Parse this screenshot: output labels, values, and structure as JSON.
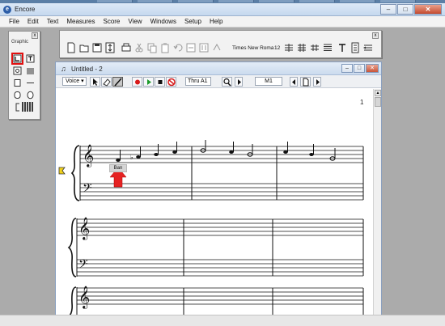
{
  "window": {
    "title": "Encore",
    "app_icon_letter": "e",
    "minimize": "–",
    "maximize": "□",
    "close": "✕"
  },
  "menubar": {
    "items": [
      "File",
      "Edit",
      "Text",
      "Measures",
      "Score",
      "View",
      "Windows",
      "Setup",
      "Help"
    ]
  },
  "palette": {
    "title": "Graphic",
    "close": "x",
    "selected_tool": "lyric-tool"
  },
  "toolbar": {
    "close": "x",
    "font_name": "Times New Roma",
    "font_size": "12"
  },
  "document": {
    "title": "Untitled - 2",
    "doc_icon": "♫",
    "minimize": "–",
    "restore": "□",
    "close": "✕",
    "voice_label": "Voice",
    "voice_arrow": "▾",
    "thru_label": "Thru A1",
    "measure_label": "M1",
    "page_number": "1",
    "lyric_text": "Ban",
    "scroll_up": "▲"
  },
  "colors": {
    "highlight_red": "#e01010",
    "arrow_red": "#e52222",
    "marker_yellow": "#f2d21a"
  }
}
